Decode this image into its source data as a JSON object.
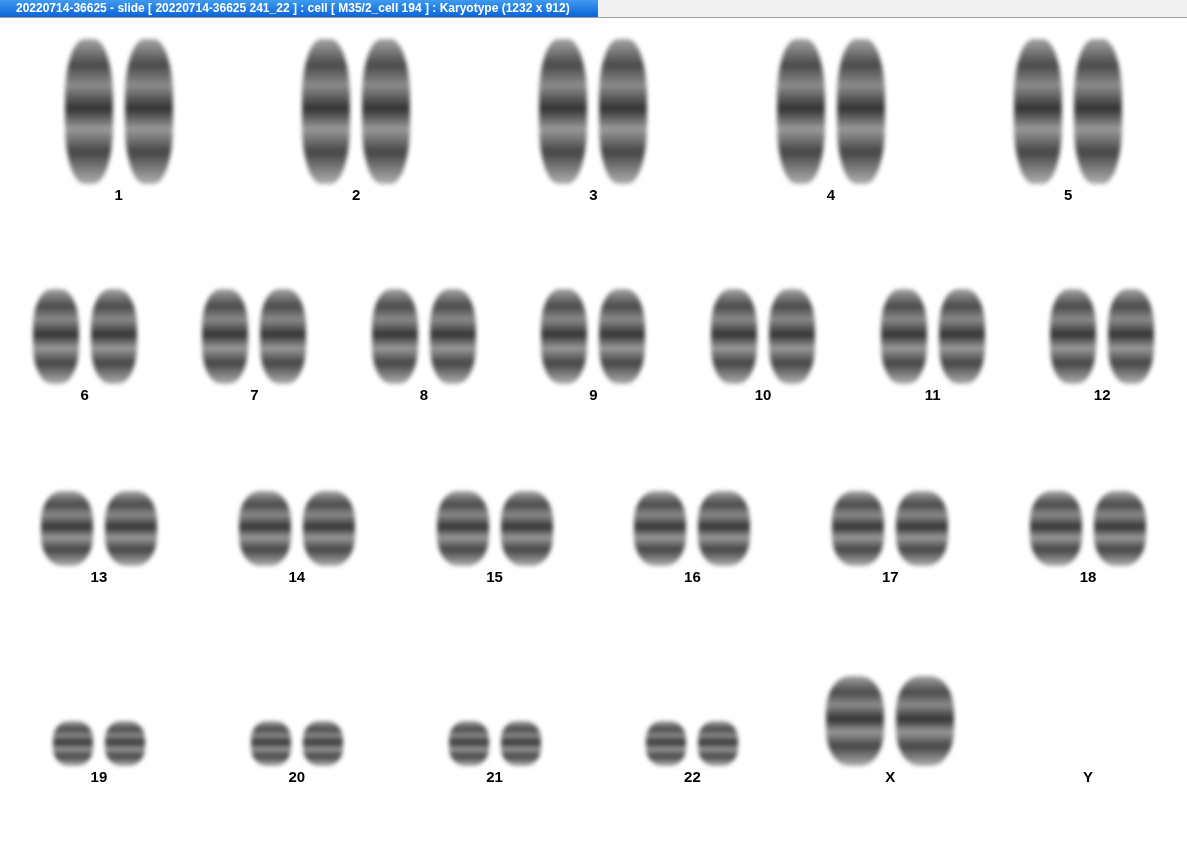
{
  "window": {
    "title": "20220714-36625 - slide [ 20220714-36625 241_22 ] : cell [ M35/2_cell 194 ] : Karyotype  (1232 x 912)"
  },
  "karyotype": {
    "rows": [
      {
        "chromosomes": [
          {
            "label": "1",
            "kind": "pair"
          },
          {
            "label": "2",
            "kind": "pair"
          },
          {
            "label": "3",
            "kind": "pair"
          },
          {
            "label": "4",
            "kind": "pair"
          },
          {
            "label": "5",
            "kind": "pair"
          }
        ]
      },
      {
        "chromosomes": [
          {
            "label": "6",
            "kind": "pair"
          },
          {
            "label": "7",
            "kind": "pair"
          },
          {
            "label": "8",
            "kind": "pair"
          },
          {
            "label": "9",
            "kind": "pair"
          },
          {
            "label": "10",
            "kind": "pair"
          },
          {
            "label": "11",
            "kind": "pair"
          },
          {
            "label": "12",
            "kind": "pair"
          }
        ]
      },
      {
        "chromosomes": [
          {
            "label": "13",
            "kind": "pair"
          },
          {
            "label": "14",
            "kind": "pair"
          },
          {
            "label": "15",
            "kind": "pair"
          },
          {
            "label": "16",
            "kind": "pair"
          },
          {
            "label": "17",
            "kind": "pair"
          },
          {
            "label": "18",
            "kind": "pair"
          }
        ]
      },
      {
        "chromosomes": [
          {
            "label": "19",
            "kind": "pair"
          },
          {
            "label": "20",
            "kind": "pair"
          },
          {
            "label": "21",
            "kind": "pair"
          },
          {
            "label": "22",
            "kind": "pair"
          },
          {
            "label": "X",
            "kind": "pair"
          },
          {
            "label": "Y",
            "kind": "empty"
          }
        ]
      }
    ]
  }
}
